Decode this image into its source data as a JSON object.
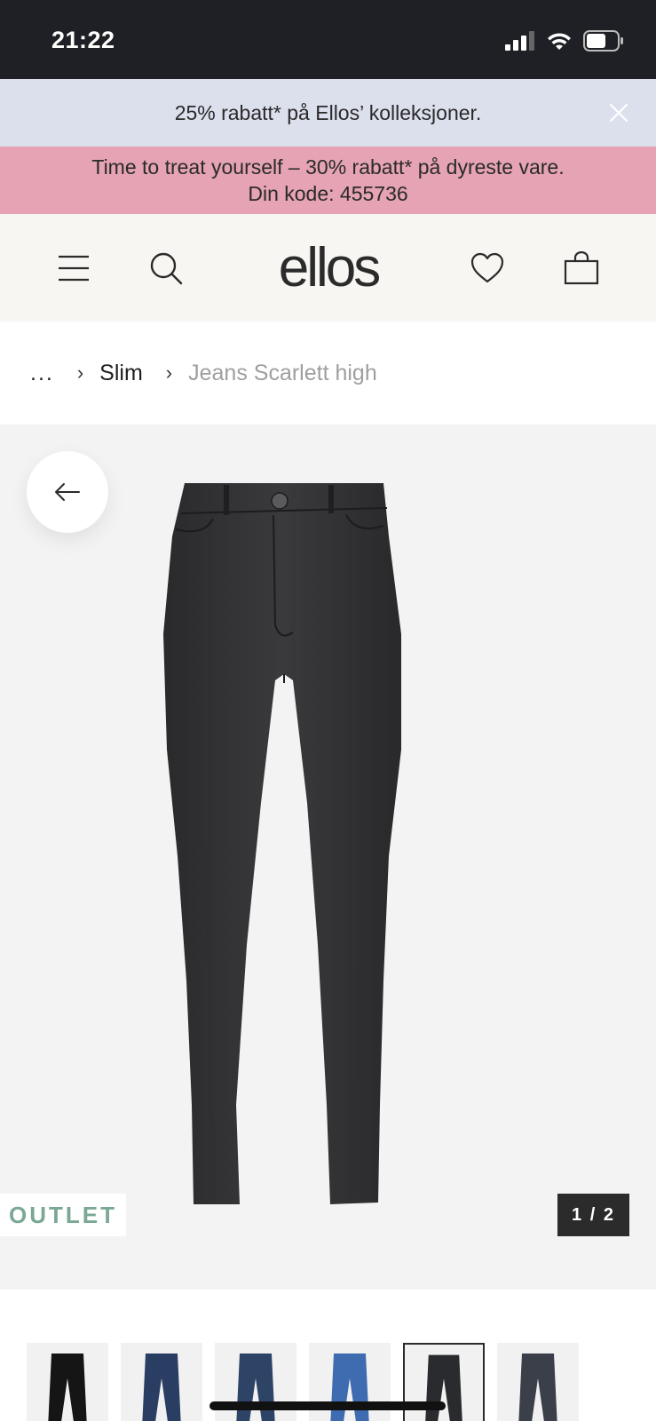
{
  "status_bar": {
    "time": "21:22"
  },
  "promo_banners": [
    {
      "text": "25% rabatt* på Ellos’ kolleksjoner.",
      "color": "#dcdfec"
    },
    {
      "text": "Time to treat yourself – 30% rabatt* på dyreste vare. Din kode: 455736",
      "color": "#e5a3b3"
    }
  ],
  "header": {
    "logo": "ellos"
  },
  "breadcrumb": {
    "ellipsis": "...",
    "parent": "Slim",
    "current": "Jeans Scarlett high"
  },
  "gallery": {
    "badge": "OUTLET",
    "counter": "1 / 2",
    "badge_color": "#7aa894"
  },
  "thumbnails": [
    {
      "color": "#151515"
    },
    {
      "color": "#2a3d63"
    },
    {
      "color": "#2e4466"
    },
    {
      "color": "#3f6bb0"
    },
    {
      "color": "#2a2b2e",
      "selected": true
    },
    {
      "color": "#3a3f4a"
    }
  ],
  "colors": {
    "accent_dark": "#2b2b2b",
    "header_bg": "#f7f6f2",
    "gallery_bg": "#f3f3f3"
  }
}
